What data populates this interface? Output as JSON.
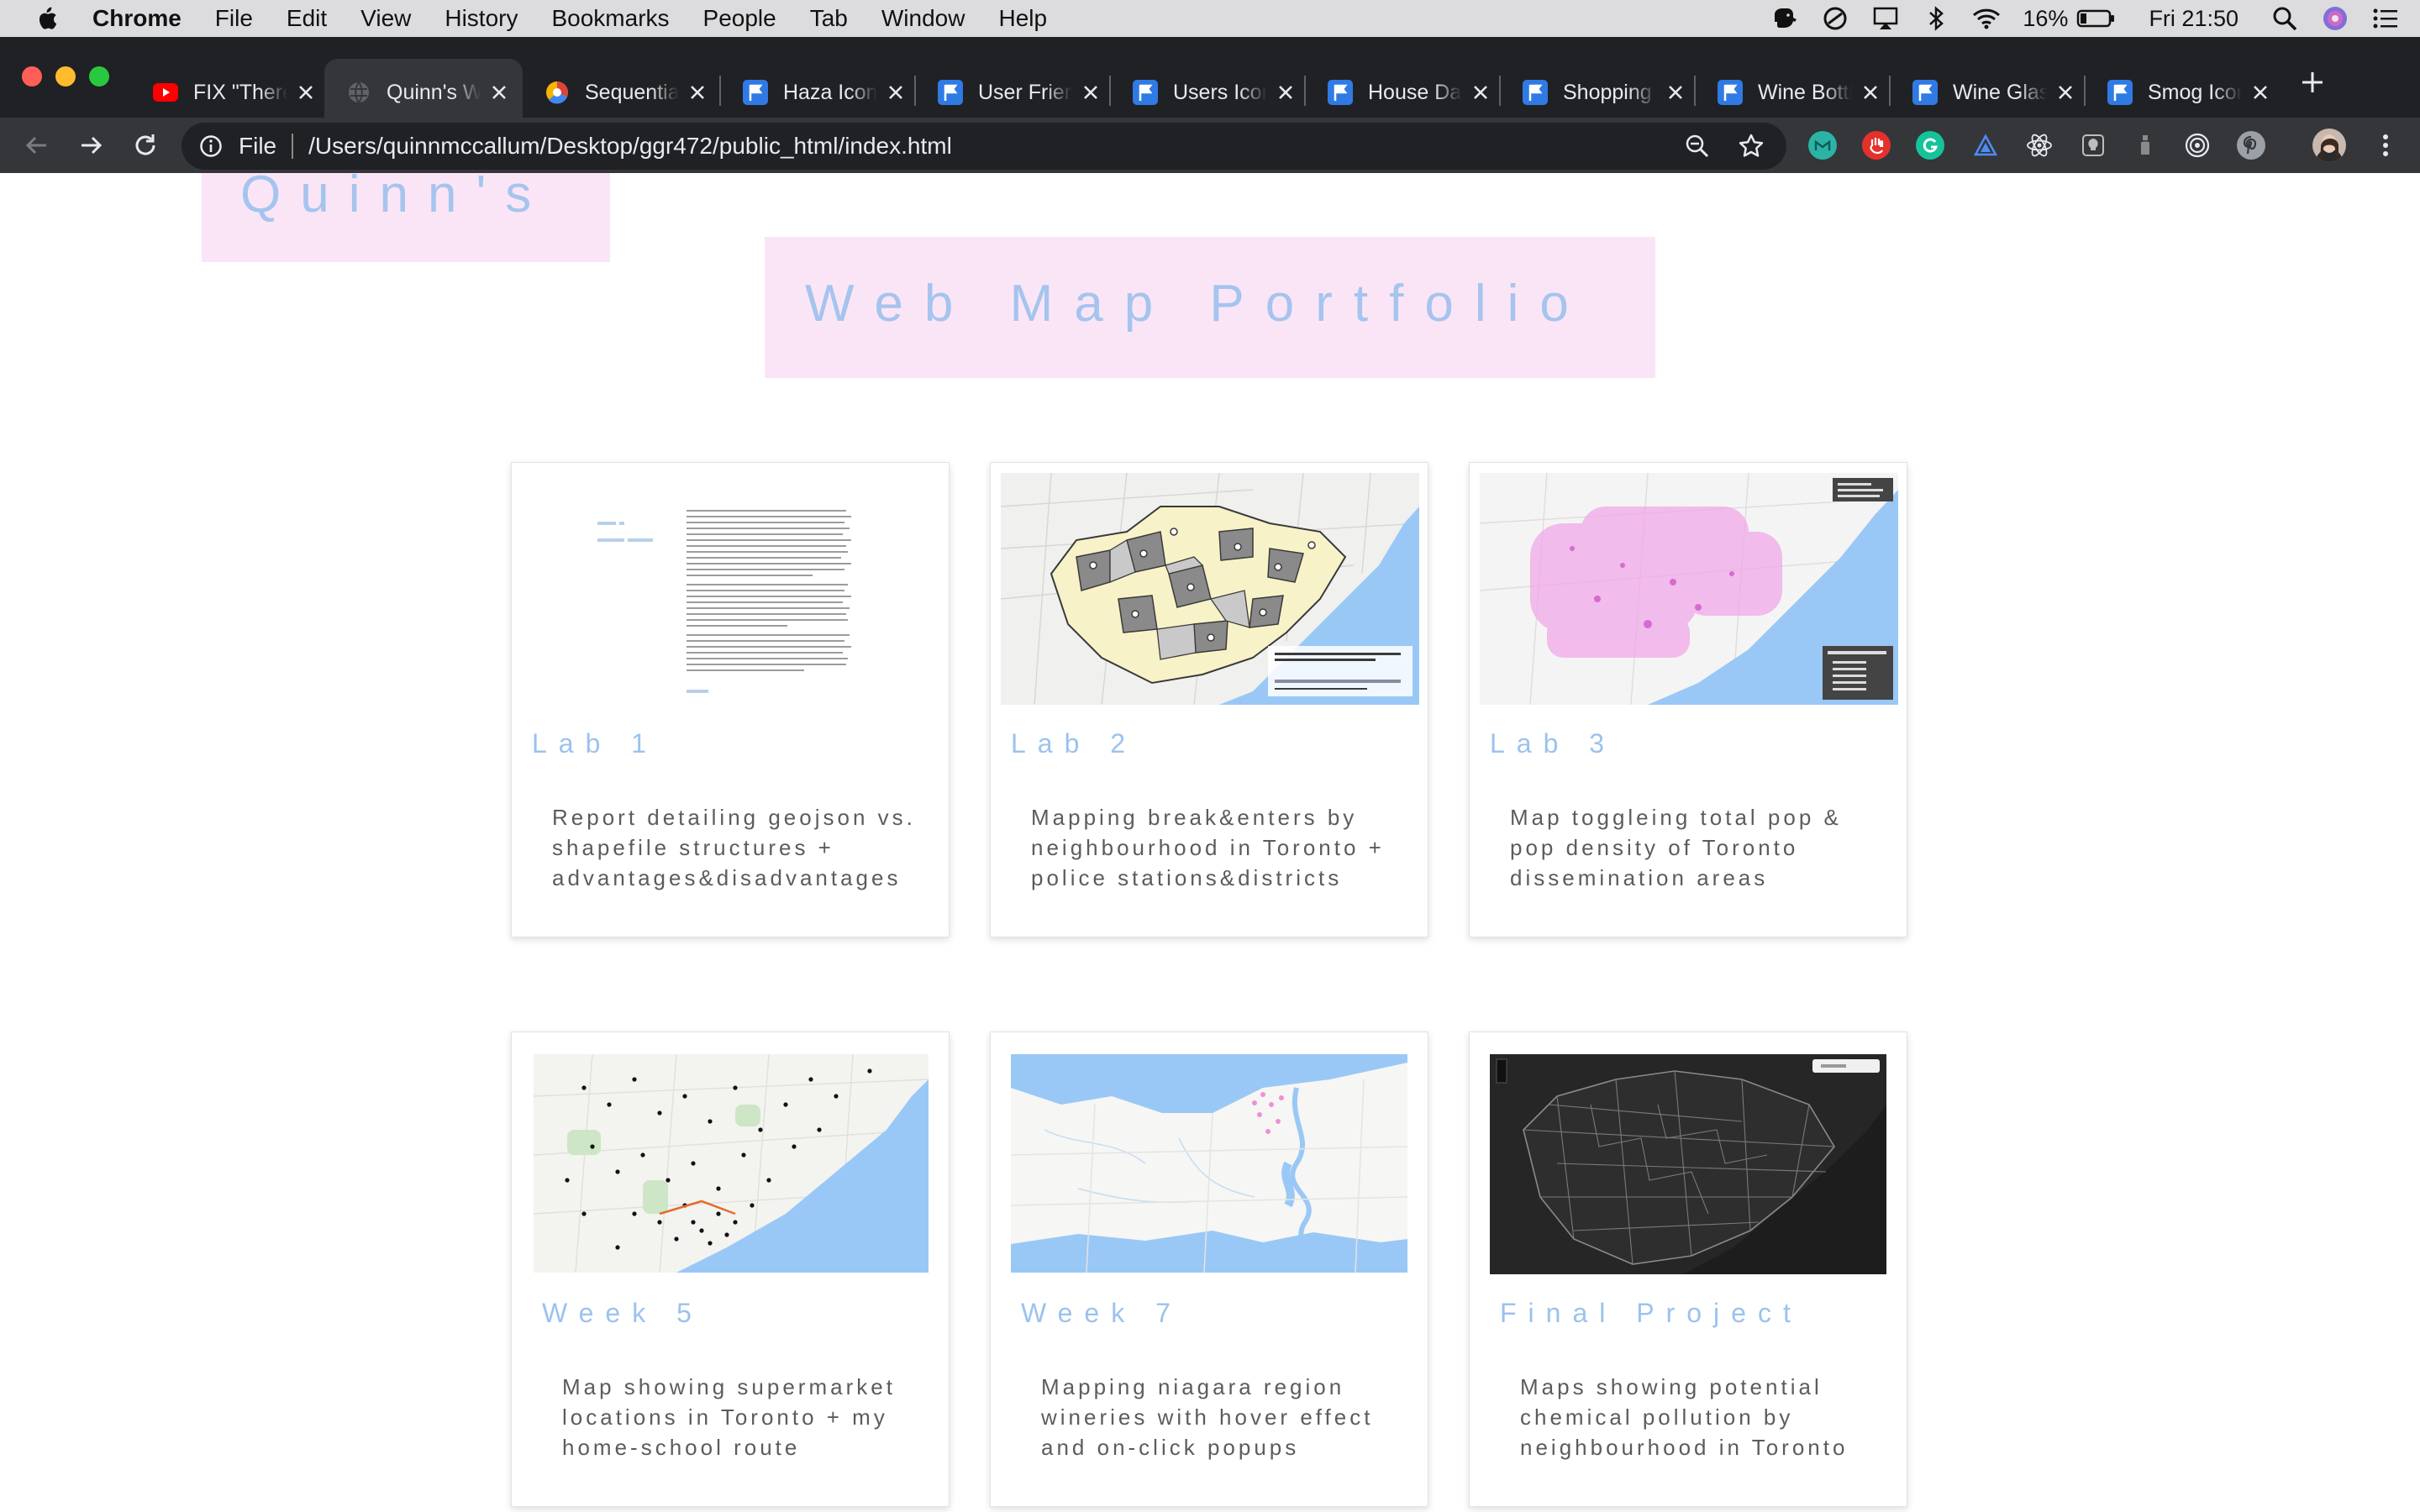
{
  "menubar": {
    "app": "Chrome",
    "items": [
      "File",
      "Edit",
      "View",
      "History",
      "Bookmarks",
      "People",
      "Tab",
      "Window",
      "Help"
    ],
    "battery": "16%",
    "clock": "Fri 21:50"
  },
  "tabs": [
    {
      "title": "FIX \"There",
      "favicon": "youtube-icon"
    },
    {
      "title": "Quinn's Web",
      "favicon": "globe-icon"
    },
    {
      "title": "Sequential",
      "favicon": "color-wheel-icon"
    },
    {
      "title": "Haza Icon",
      "favicon": "flag-icon"
    },
    {
      "title": "User Friendly",
      "favicon": "flag-icon"
    },
    {
      "title": "Users Icon",
      "favicon": "flag-icon"
    },
    {
      "title": "House Data",
      "favicon": "flag-icon"
    },
    {
      "title": "Shopping",
      "favicon": "flag-icon"
    },
    {
      "title": "Wine Bottle",
      "favicon": "flag-icon"
    },
    {
      "title": "Wine Glass",
      "favicon": "flag-icon"
    },
    {
      "title": "Smog Icon",
      "favicon": "flag-icon"
    }
  ],
  "omnibox": {
    "scheme": "File",
    "url": "/Users/quinnmccallum/Desktop/ggr472/public_html/index.html"
  },
  "page": {
    "title_top": "Quinn's",
    "title_main": "Web Map Portfolio",
    "cards": [
      {
        "title": "Lab 1",
        "description": "Report detailing geojson vs. shapefile structures + advantages&disadvantages"
      },
      {
        "title": "Lab 2",
        "description": "Mapping break&enters by neighbourhood in Toronto + police stations&districts"
      },
      {
        "title": "Lab 3",
        "description": "Map toggleing total pop & pop density of Toronto dissemination areas"
      },
      {
        "title": "Week 5",
        "description": "Map showing supermarket locations in Toronto + my home-school route"
      },
      {
        "title": "Week 7",
        "description": "Mapping niagara region wineries with hover effect and on-click popups"
      },
      {
        "title": "Final Project",
        "description": "Maps showing potential chemical pollution by neighbourhood in Toronto"
      }
    ]
  },
  "colors": {
    "title_pink_bg": "#fae5f7",
    "title_blue_text": "#a5c4ee",
    "card_title_blue": "#9cc2ee",
    "water_blue": "#9ac8f6"
  }
}
